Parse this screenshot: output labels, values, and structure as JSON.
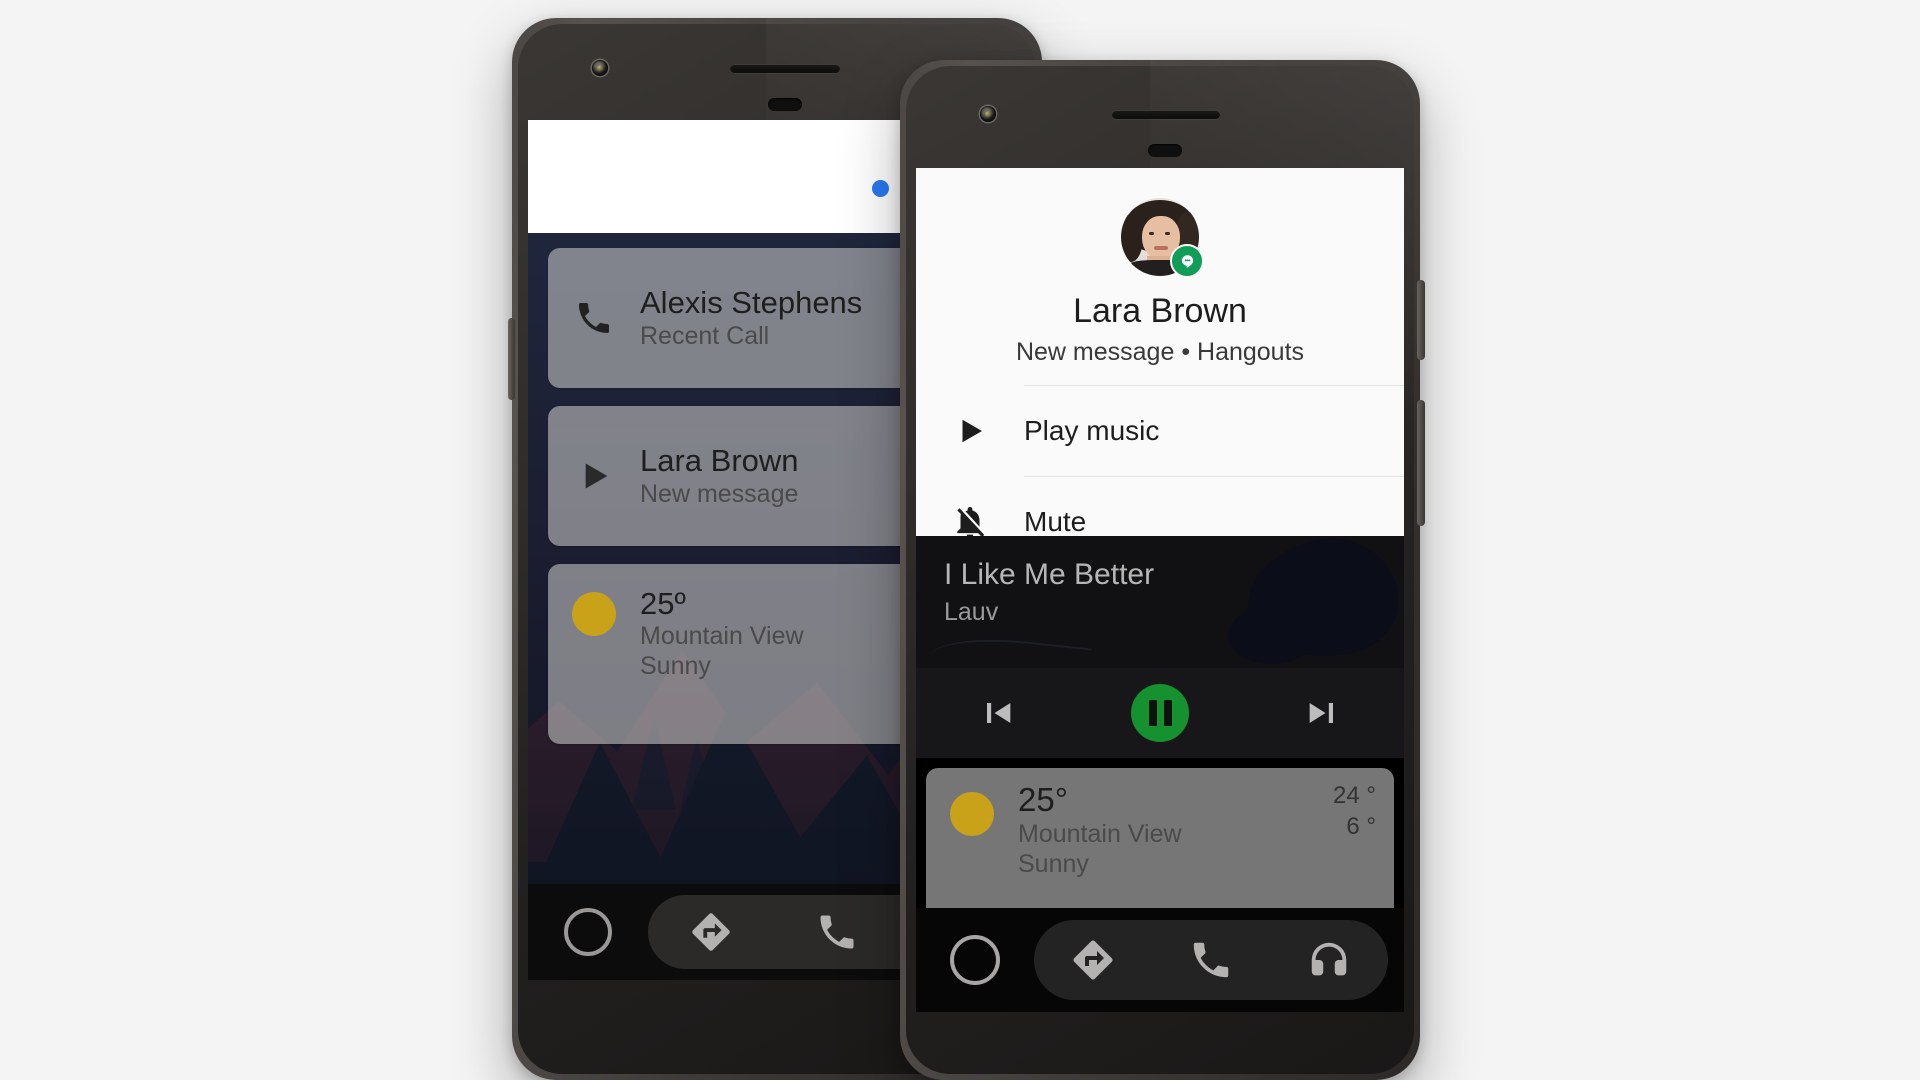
{
  "page": {
    "background_color": "#f4f4f4",
    "title": "Android Auto phone screens"
  },
  "back_phone": {
    "name": "back-phone",
    "assistant": {
      "dots": [
        {
          "name": "assistant-dot-blue",
          "color": "#2979f1"
        },
        {
          "name": "assistant-dot-red",
          "color": "#ea3a27"
        },
        {
          "name": "assistant-dot-yellow",
          "color": "#f9ba07"
        },
        {
          "name": "assistant-dot-green",
          "color": "#23a14c"
        }
      ]
    },
    "cards": [
      {
        "icon": "phone-icon",
        "title": "Alexis Stephens",
        "subtitle": "Recent Call"
      },
      {
        "icon": "play-icon",
        "title": "Lara Brown",
        "subtitle": "New message"
      },
      {
        "icon": "sun-icon",
        "title": "25º",
        "subtitle": "Mountain View",
        "subtitle2": "Sunny"
      }
    ],
    "nav": {
      "home_label": "home-icon",
      "items": [
        "navigation-icon",
        "phone-icon"
      ]
    }
  },
  "front_phone": {
    "name": "front-phone",
    "notification": {
      "avatar_alt": "Lara Brown avatar",
      "badge": "hangouts-icon",
      "name": "Lara Brown",
      "subtitle": "New message • Hangouts",
      "actions": [
        {
          "icon": "play-icon",
          "label": "Play music"
        },
        {
          "icon": "bell-off-icon",
          "label": "Mute"
        }
      ]
    },
    "player": {
      "track_title": "I Like Me Better",
      "artist": "Lauv",
      "controls": {
        "previous": "skip-previous-icon",
        "play_pause": "pause-icon",
        "next": "skip-next-icon",
        "play_button_color": "#15912f",
        "state": "playing"
      }
    },
    "weather": {
      "icon": "sun-icon",
      "temperature": "25°",
      "location": "Mountain View",
      "condition": "Sunny",
      "high": "24 °",
      "low": "6 °"
    },
    "nav": {
      "home_label": "home-icon",
      "items": [
        "navigation-icon",
        "phone-icon",
        "headphones-icon"
      ]
    }
  }
}
